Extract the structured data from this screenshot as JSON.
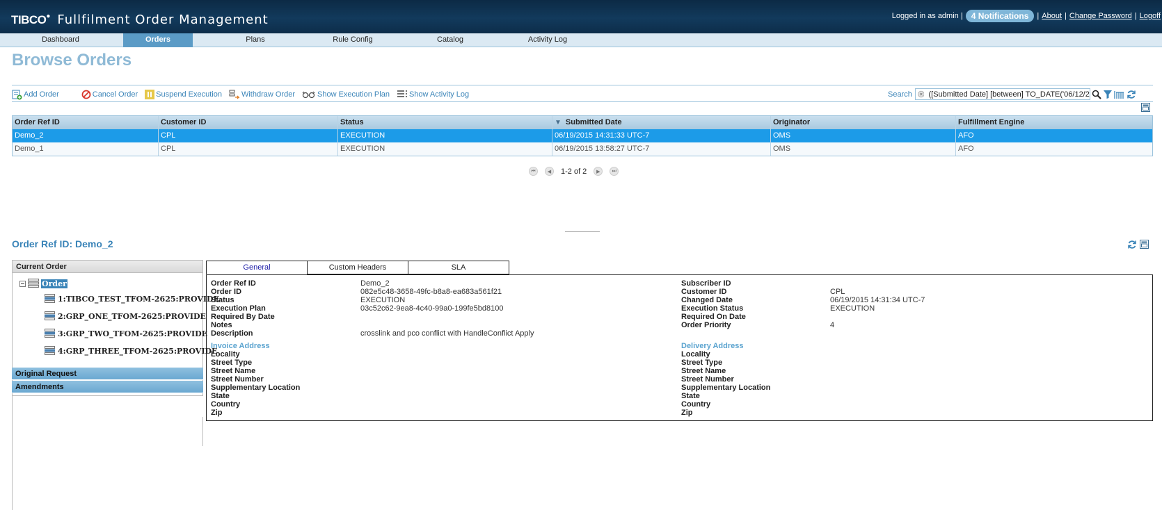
{
  "header": {
    "logo": "TIBCO",
    "product": "Fullfilment Order Management",
    "logged_in": "Logged in as admin |",
    "notifications": "4 Notifications",
    "links": [
      "About",
      "Change Password",
      "Logoff"
    ],
    "separator": "|"
  },
  "nav": {
    "items": [
      "Dashboard",
      "Orders",
      "Plans",
      "Rule Config",
      "Catalog",
      "Activity Log"
    ],
    "active": "Orders"
  },
  "page_title": "Browse Orders",
  "toolbar": {
    "add": "Add Order",
    "cancel": "Cancel Order",
    "suspend": "Suspend Execution",
    "withdraw": "Withdraw Order",
    "show_plan": "Show Execution Plan",
    "show_log": "Show Activity Log"
  },
  "search": {
    "label": "Search",
    "value": "([Submitted Date] [between] TO_DATE('06/12/2"
  },
  "orders_table": {
    "columns": [
      "Order Ref ID",
      "Customer ID",
      "Status",
      "Submitted Date",
      "Originator",
      "Fulfillment Engine"
    ],
    "rows": [
      [
        "Demo_2",
        "CPL",
        "EXECUTION",
        "06/19/2015 14:31:33 UTC-7",
        "OMS",
        "AFO"
      ],
      [
        "Demo_1",
        "CPL",
        "EXECUTION",
        "06/19/2015 13:58:27 UTC-7",
        "OMS",
        "AFO"
      ]
    ],
    "selected_row": 0
  },
  "pager": {
    "text": "1-2 of 2"
  },
  "detail": {
    "title": "Order Ref ID: Demo_2",
    "left_panel": {
      "header": "Current Order",
      "root": "Order",
      "items": [
        "1:TIBCO_TEST_TFOM-2625:PROVIDE",
        "2:GRP_ONE_TFOM-2625:PROVIDE",
        "3:GRP_TWO_TFOM-2625:PROVIDE",
        "4:GRP_THREE_TFOM-2625:PROVIDE"
      ],
      "sections": [
        "Original Request",
        "Amendments"
      ]
    },
    "tabs": [
      "General",
      "Custom Headers",
      "SLA"
    ],
    "active_tab": "General",
    "left_fields": [
      {
        "label": "Order Ref ID",
        "value": "Demo_2"
      },
      {
        "label": "Order ID",
        "value": "082e5c48-3658-49fc-b8a8-ea683a561f21"
      },
      {
        "label": "Status",
        "value": "EXECUTION"
      },
      {
        "label": "Execution Plan",
        "value": "03c52c62-9ea8-4c40-99a0-199fe5bd8100"
      },
      {
        "label": "Required By Date",
        "value": ""
      },
      {
        "label": "Notes",
        "value": ""
      },
      {
        "label": "Description",
        "value": "crosslink and pco conflict with HandleConflict Apply"
      }
    ],
    "right_fields": [
      {
        "label": "Subscriber ID",
        "value": ""
      },
      {
        "label": "Customer ID",
        "value": "CPL"
      },
      {
        "label": "Changed Date",
        "value": "06/19/2015 14:31:34 UTC-7"
      },
      {
        "label": "Execution Status",
        "value": "EXECUTION"
      },
      {
        "label": "Required On Date",
        "value": ""
      },
      {
        "label": "Order Priority",
        "value": "4"
      }
    ],
    "invoice_title": "Invoice Address",
    "delivery_title": "Delivery Address",
    "address_fields": [
      "Locality",
      "Street Type",
      "Street Name",
      "Street Number",
      "Supplementary Location",
      "State",
      "Country",
      "Zip"
    ]
  }
}
